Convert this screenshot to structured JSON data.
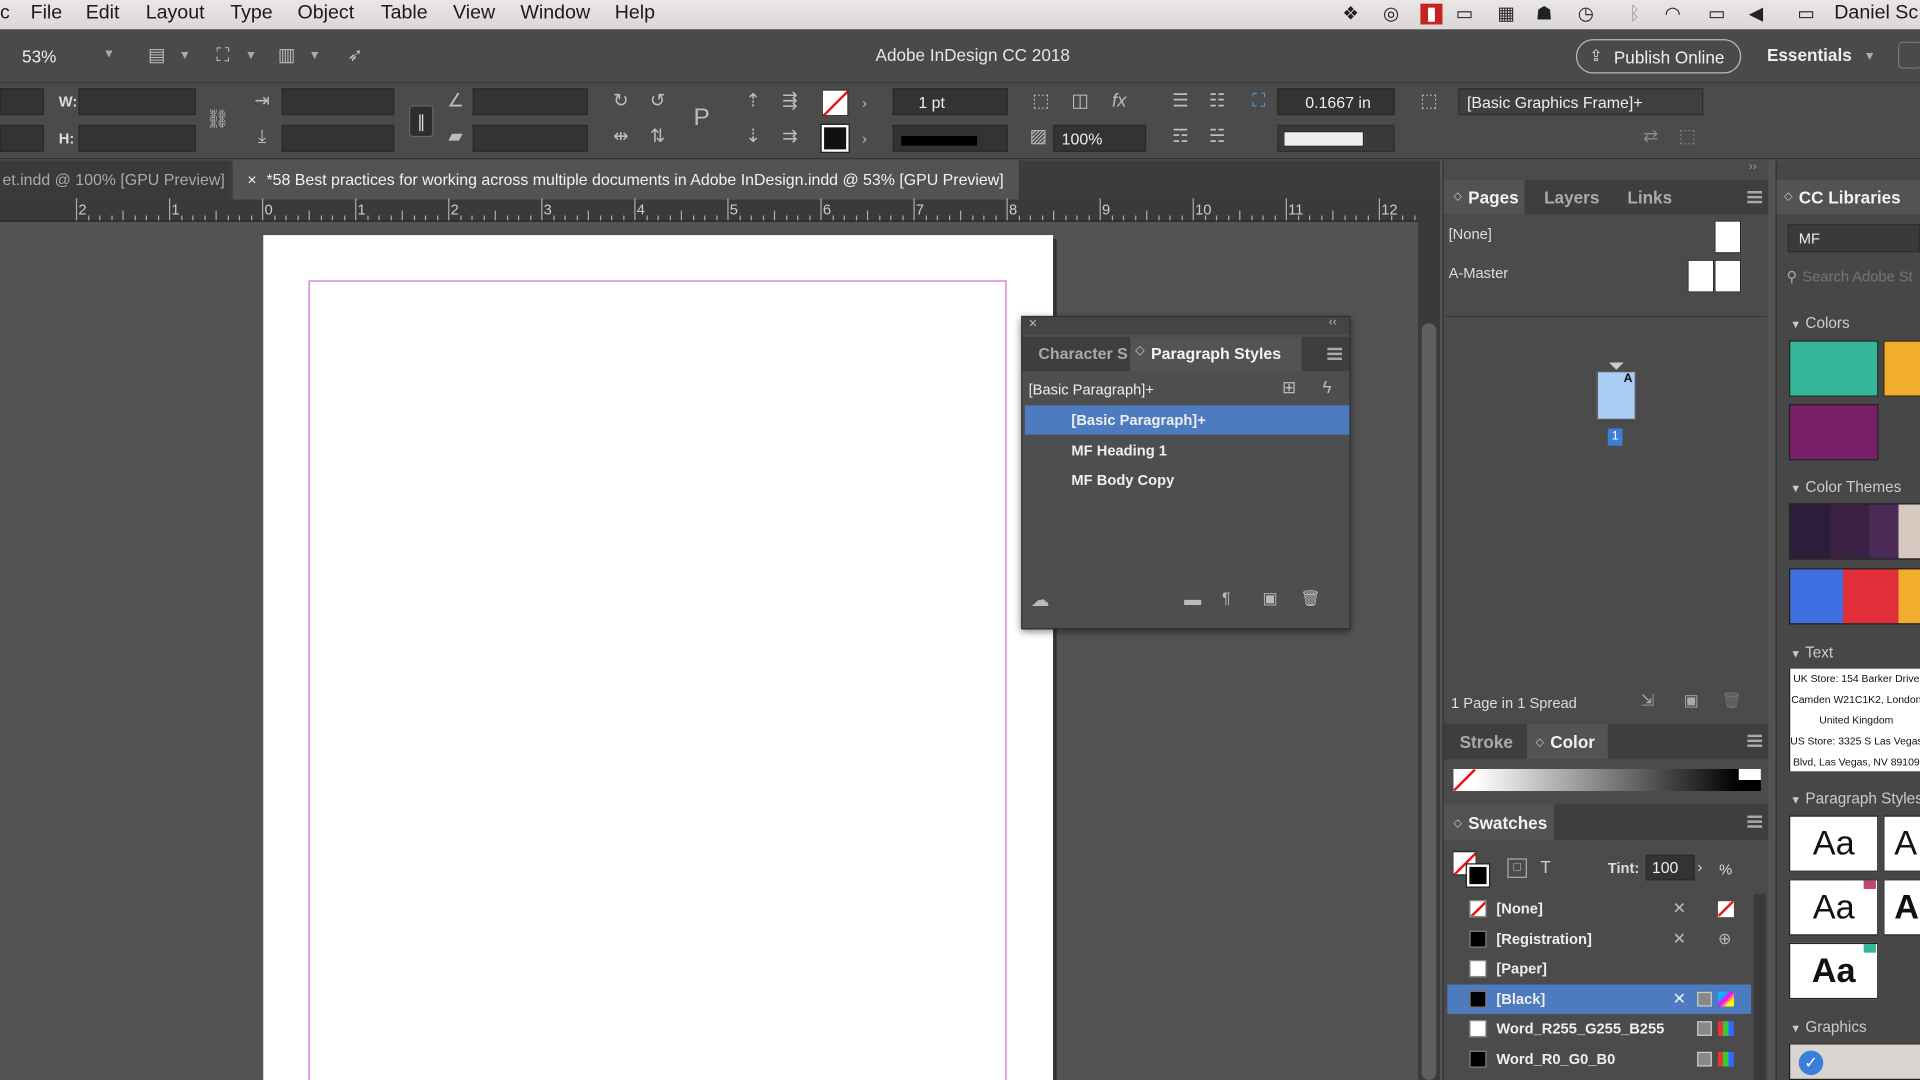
{
  "menubar": {
    "apple_partial": "c",
    "items": [
      "File",
      "Edit",
      "Layout",
      "Type",
      "Object",
      "Table",
      "View",
      "Window",
      "Help"
    ],
    "user": "Daniel Sc"
  },
  "control": {
    "zoom": "53%",
    "app_title": "Adobe InDesign CC 2018",
    "publish_label": "Publish Online",
    "workspace": "Essentials"
  },
  "transform": {
    "w_label": "W:",
    "h_label": "H:",
    "stroke_weight": "1 pt",
    "opacity": "100%",
    "offset": "0.1667 in",
    "object_style": "[Basic Graphics Frame]+"
  },
  "doctabs": {
    "tab1": "et.indd @ 100% [GPU Preview]",
    "tab2": "*58 Best practices for working across multiple documents in Adobe InDesign.indd @ 53% [GPU Preview]"
  },
  "ruler": [
    "2",
    "1",
    "0",
    "1",
    "2",
    "3",
    "4",
    "5",
    "6",
    "7",
    "8",
    "9",
    "10",
    "11",
    "12"
  ],
  "para_panel": {
    "tab_char": "Character S",
    "tab_para": "Paragraph Styles",
    "current": "[Basic Paragraph]+",
    "items": [
      "[Basic Paragraph]+",
      "MF Heading 1",
      "MF Body Copy"
    ]
  },
  "pages_panel": {
    "tabs": [
      "Pages",
      "Layers",
      "Links"
    ],
    "none": "[None]",
    "master": "A-Master",
    "page_letter": "A",
    "page_num": "1",
    "status": "1 Page in 1 Spread"
  },
  "color_panel": {
    "tabs": [
      "Stroke",
      "Color"
    ]
  },
  "swatches": {
    "title": "Swatches",
    "tint_label": "Tint:",
    "tint": "100",
    "pct": "%",
    "items": [
      "[None]",
      "[Registration]",
      "[Paper]",
      "[Black]",
      "Word_R255_G255_B255",
      "Word_R0_G0_B0"
    ]
  },
  "cc": {
    "title": "CC Libraries",
    "library": "MF",
    "search_ph": "Search Adobe St",
    "sections": [
      "Colors",
      "Color Themes",
      "Text",
      "Paragraph Styles",
      "Graphics"
    ],
    "text_lines": [
      "UK Store: 154 Barker Drive",
      "Camden W21C1K2, London",
      "United Kingdom",
      "US Store: 3325 S Las Vegas",
      "Blvd, Las Vegas, NV 89109"
    ],
    "aa": "Aa",
    "aa_partial": "A"
  },
  "colors": {
    "accent": "#4c7bbf",
    "teal": "#35b59a",
    "orange": "#f1ad2b",
    "magenta": "#7a2068",
    "theme_dark": "#3b2245",
    "blue": "#3f6fe0",
    "red": "#e1303b"
  }
}
